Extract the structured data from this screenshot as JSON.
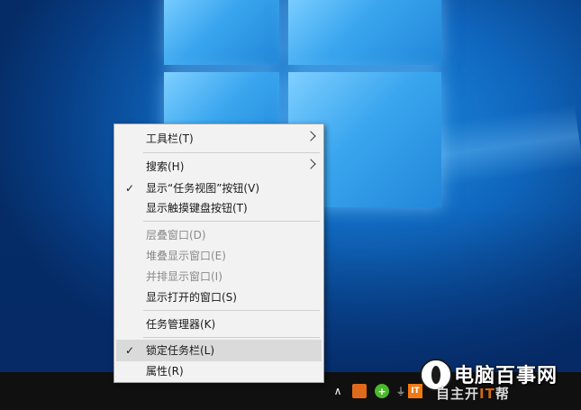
{
  "context_menu": {
    "items": [
      {
        "label": "工具栏(T)",
        "checked": false,
        "disabled": false,
        "has_submenu": true
      },
      {
        "label": "搜索(H)",
        "checked": false,
        "disabled": false,
        "has_submenu": true
      },
      {
        "label": "显示“任务视图”按钮(V)",
        "checked": true,
        "disabled": false,
        "has_submenu": false
      },
      {
        "label": "显示触摸键盘按钮(T)",
        "checked": false,
        "disabled": false,
        "has_submenu": false
      },
      {
        "label": "层叠窗口(D)",
        "checked": false,
        "disabled": true,
        "has_submenu": false
      },
      {
        "label": "堆叠显示窗口(E)",
        "checked": false,
        "disabled": true,
        "has_submenu": false
      },
      {
        "label": "并排显示窗口(I)",
        "checked": false,
        "disabled": true,
        "has_submenu": false
      },
      {
        "label": "显示打开的窗口(S)",
        "checked": false,
        "disabled": false,
        "has_submenu": false
      },
      {
        "label": "任务管理器(K)",
        "checked": false,
        "disabled": false,
        "has_submenu": false
      },
      {
        "label": "锁定任务栏(L)",
        "checked": true,
        "disabled": false,
        "has_submenu": false,
        "highlighted": true
      },
      {
        "label": "属性(R)",
        "checked": false,
        "disabled": false,
        "has_submenu": false
      }
    ],
    "check_mark": "✓"
  },
  "taskbar": {
    "tray_icons": [
      "chevron-up-icon",
      "shopping-bag-icon",
      "add-circle-icon",
      "usb-icon",
      "it-logo-icon"
    ],
    "chevron_glyph": "∧",
    "plus_glyph": "+",
    "usb_glyph": "⏚",
    "it_glyph": "IT"
  },
  "watermark": {
    "title": "电脑百事网",
    "sub_prefix": "自主",
    "sub_middle": "开",
    "sub_it": "IT",
    "sub_suffix": "帮"
  }
}
